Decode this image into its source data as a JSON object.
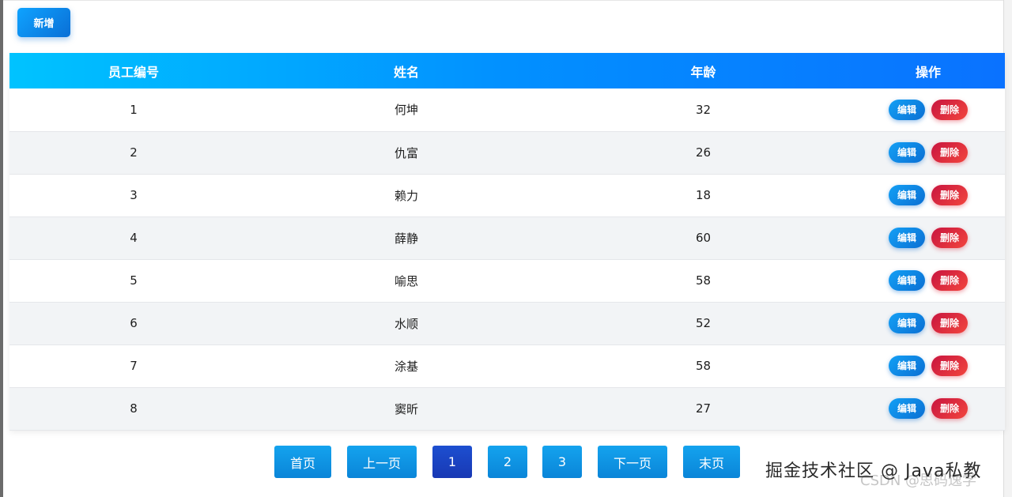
{
  "toolbar": {
    "add_label": "新增"
  },
  "table": {
    "headers": [
      "员工编号",
      "姓名",
      "年龄",
      "操作"
    ],
    "edit_label": "编辑",
    "delete_label": "删除",
    "rows": [
      {
        "id": "1",
        "name": "何坤",
        "age": "32"
      },
      {
        "id": "2",
        "name": "仇富",
        "age": "26"
      },
      {
        "id": "3",
        "name": "赖力",
        "age": "18"
      },
      {
        "id": "4",
        "name": "薛静",
        "age": "60"
      },
      {
        "id": "5",
        "name": "喻思",
        "age": "58"
      },
      {
        "id": "6",
        "name": "水顺",
        "age": "52"
      },
      {
        "id": "7",
        "name": "涂基",
        "age": "58"
      },
      {
        "id": "8",
        "name": "窦昕",
        "age": "27"
      }
    ]
  },
  "pagination": {
    "first": "首页",
    "prev": "上一页",
    "pages": [
      "1",
      "2",
      "3"
    ],
    "current_page": "1",
    "next": "下一页",
    "last": "末页"
  },
  "watermark": {
    "text": "掘金技术社区 @ Java私教",
    "sub_text": "CSDN @思码逸学"
  },
  "colors": {
    "header_gradient_start": "#00c3ff",
    "header_gradient_end": "#0a72ff",
    "edit_button": "#0b6fd3",
    "delete_button": "#e0283c",
    "active_page": "#1838b4"
  }
}
